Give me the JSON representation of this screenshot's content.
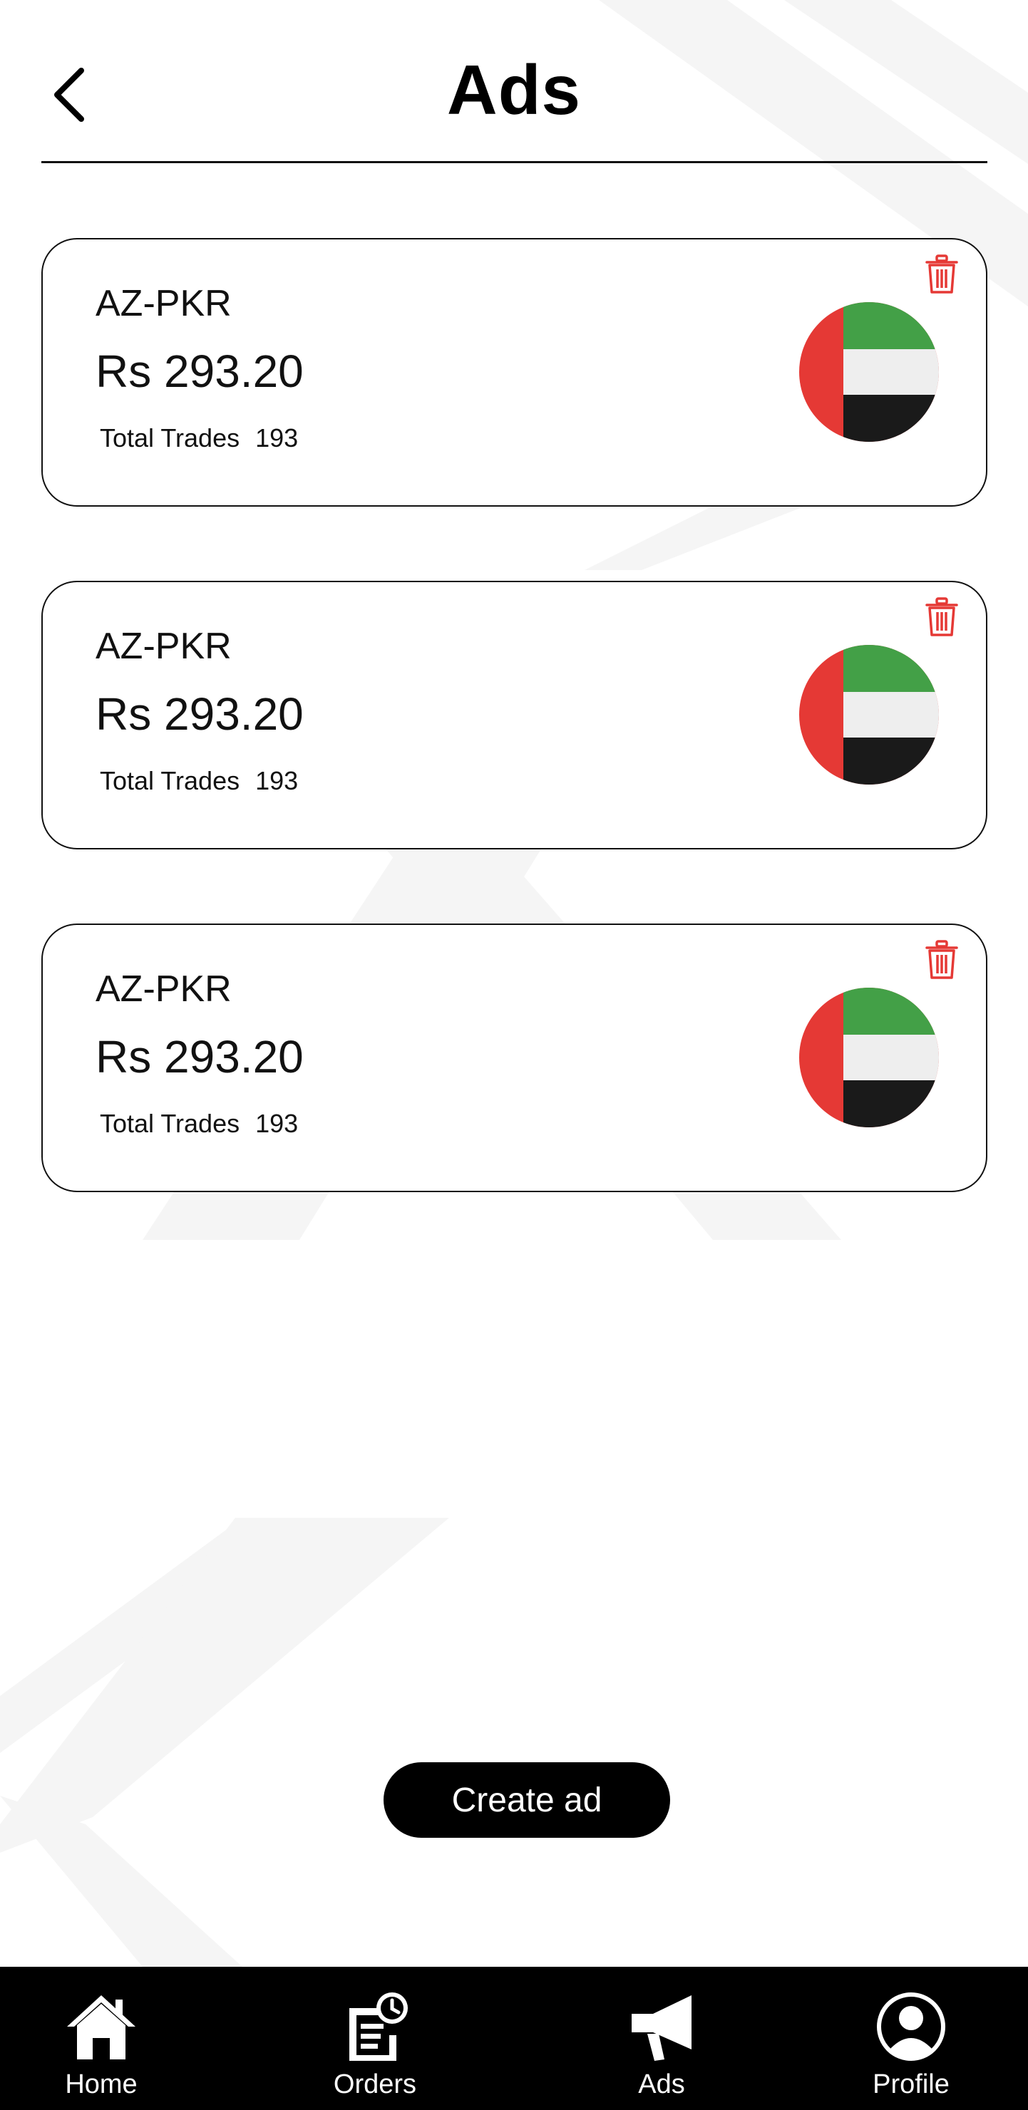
{
  "header": {
    "title": "Ads",
    "back_icon": "chevron-left-icon"
  },
  "ads": [
    {
      "pair": "AZ-PKR",
      "price": "Rs 293.20",
      "trades_label": "Total Trades",
      "trades_count": "193",
      "flag": "uae-flag-icon"
    },
    {
      "pair": "AZ-PKR",
      "price": "Rs 293.20",
      "trades_label": "Total Trades",
      "trades_count": "193",
      "flag": "uae-flag-icon"
    },
    {
      "pair": "AZ-PKR",
      "price": "Rs 293.20",
      "trades_label": "Total Trades",
      "trades_count": "193",
      "flag": "uae-flag-icon"
    }
  ],
  "create_button": {
    "label": "Create ad"
  },
  "bottom_nav": {
    "items": [
      {
        "label": "Home",
        "icon": "home-icon"
      },
      {
        "label": "Orders",
        "icon": "orders-icon"
      },
      {
        "label": "Ads",
        "icon": "megaphone-icon"
      },
      {
        "label": "Profile",
        "icon": "profile-icon"
      }
    ]
  },
  "colors": {
    "accent": "#000000",
    "delete": "#e53935",
    "flag_red": "#e53935",
    "flag_green": "#43a047",
    "flag_white": "#eeeeee",
    "flag_black": "#1a1a1a"
  }
}
